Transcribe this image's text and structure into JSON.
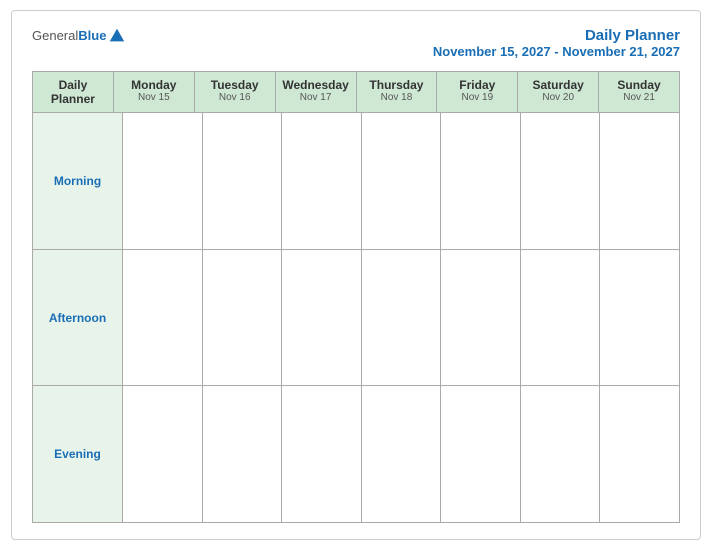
{
  "logo": {
    "general": "General",
    "blue": "Blue"
  },
  "title": {
    "main": "Daily Planner",
    "date_range": "November 15, 2027 - November 21, 2027"
  },
  "calendar": {
    "header": [
      {
        "id": "label-col",
        "name": "Daily\nPlanner",
        "date": ""
      },
      {
        "id": "monday",
        "name": "Monday",
        "date": "Nov 15"
      },
      {
        "id": "tuesday",
        "name": "Tuesday",
        "date": "Nov 16"
      },
      {
        "id": "wednesday",
        "name": "Wednesday",
        "date": "Nov 17"
      },
      {
        "id": "thursday",
        "name": "Thursday",
        "date": "Nov 18"
      },
      {
        "id": "friday",
        "name": "Friday",
        "date": "Nov 19"
      },
      {
        "id": "saturday",
        "name": "Saturday",
        "date": "Nov 20"
      },
      {
        "id": "sunday",
        "name": "Sunday",
        "date": "Nov 21"
      }
    ],
    "rows": [
      {
        "label": "Morning"
      },
      {
        "label": "Afternoon"
      },
      {
        "label": "Evening"
      }
    ]
  }
}
